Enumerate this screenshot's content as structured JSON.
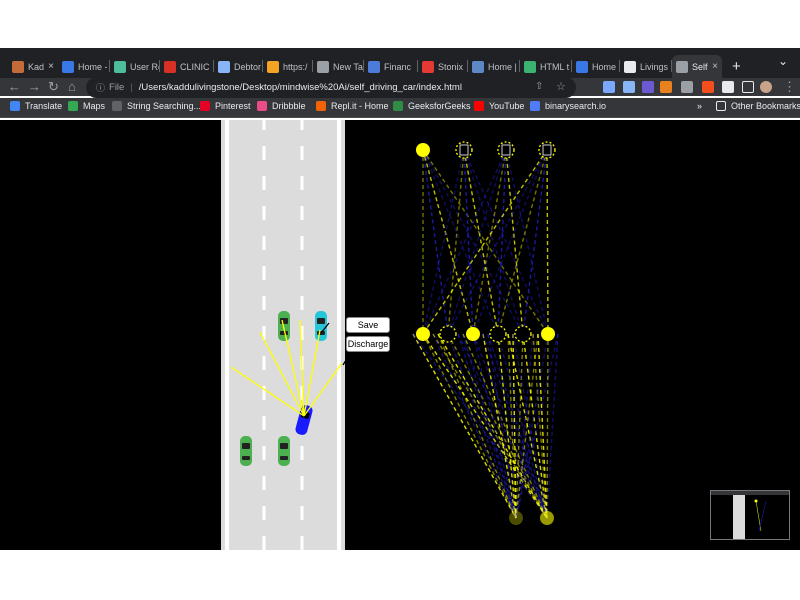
{
  "browser": {
    "tabs": [
      {
        "label": "Kad",
        "color": "#c56b3a"
      },
      {
        "label": "Home -",
        "color": "#3b78e7"
      },
      {
        "label": "User Re",
        "color": "#4dbd9b"
      },
      {
        "label": "CLINIC",
        "color": "#d93025"
      },
      {
        "label": "Debtor",
        "color": "#8ab4f8"
      },
      {
        "label": "https:/",
        "color": "#f4a324"
      },
      {
        "label": "New Ta",
        "color": "#9aa0a6"
      },
      {
        "label": "Financ",
        "color": "#4c7bd9"
      },
      {
        "label": "Stonix",
        "color": "#e53935"
      },
      {
        "label": "Home |",
        "color": "#5c88c5"
      },
      {
        "label": "HTML t",
        "color": "#3cb371"
      },
      {
        "label": "Home -",
        "color": "#3b78e7"
      },
      {
        "label": "Livings",
        "color": "#e8eaed"
      },
      {
        "label": "Self",
        "color": "#9aa0a6"
      }
    ],
    "address": {
      "scheme": "File",
      "url": "/Users/kaddulivingstone/Desktop/mindwise%20Ai/self_driving_car/index.html"
    },
    "bookmarks": [
      {
        "label": "Translate",
        "color": "#4285f4"
      },
      {
        "label": "Maps",
        "color": "#34a853"
      },
      {
        "label": "String Searching...",
        "color": "#5f6368"
      },
      {
        "label": "Pinterest",
        "color": "#e60023"
      },
      {
        "label": "Dribbble",
        "color": "#ea4c89"
      },
      {
        "label": "Repl.it - Home",
        "color": "#f26207"
      },
      {
        "label": "GeeksforGeeks",
        "color": "#2f8d46"
      },
      {
        "label": "YouTube",
        "color": "#ff0000"
      },
      {
        "label": "binarysearch.io",
        "color": "#4f7df9"
      }
    ],
    "other_bookmarks": "Other Bookmarks"
  },
  "controls": {
    "save_label": "Save",
    "discard_label": "Discharge"
  },
  "colors": {
    "road": "#dcdcdc",
    "lane_line": "#ffffff",
    "car_traffic": "#4caf50",
    "car_traffic_alt": "#26c6da",
    "car_player": "#1a1aff",
    "sensor": "#ffff00",
    "network_positive": "#ffff00",
    "network_negative": "#2323d9"
  },
  "network": {
    "layers": [
      [
        1,
        0,
        0,
        0
      ],
      [
        1,
        0,
        1,
        0,
        1
      ],
      [
        0.3,
        0.6
      ]
    ]
  }
}
